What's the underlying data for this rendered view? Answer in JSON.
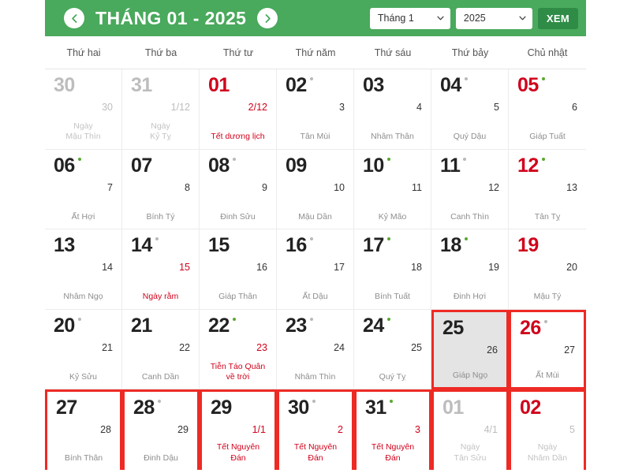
{
  "header": {
    "prev_icon": "chevron-left-icon",
    "next_icon": "chevron-right-icon",
    "title": "THÁNG 01 - 2025",
    "month_select_value": "Tháng 1",
    "year_select_value": "2025",
    "view_button_label": "XEM",
    "chevron_icon": "chevron-down-icon",
    "background_color": "#49a95c",
    "button_color": "#2f8c47"
  },
  "weekdays": [
    "Thứ hai",
    "Thứ ba",
    "Thứ tư",
    "Thứ năm",
    "Thứ sáu",
    "Thứ bảy",
    "Chủ nhật"
  ],
  "colors": {
    "holiday_red": "#d0021b",
    "marked_border": "#ee2a24",
    "good_day_dot": "#5aa832",
    "normal_day_dot": "#b9b9b9",
    "today_background": "#e4e4e4",
    "muted_text": "#bdbdbd"
  },
  "days": [
    {
      "day": "30",
      "lunar": "30",
      "label": "Ngày\nMậu Thìn",
      "dot": "none",
      "classes": "out"
    },
    {
      "day": "31",
      "lunar": "1/12",
      "label": "Ngày\nKỷ Tỵ",
      "dot": "none",
      "classes": "out"
    },
    {
      "day": "01",
      "lunar": "2/12",
      "label": "Tết dương lịch",
      "dot": "none",
      "classes": "red-num holiday"
    },
    {
      "day": "02",
      "lunar": "3",
      "label": "Tân Mùi",
      "dot": "grey",
      "classes": ""
    },
    {
      "day": "03",
      "lunar": "4",
      "label": "Nhâm Thân",
      "dot": "none",
      "classes": ""
    },
    {
      "day": "04",
      "lunar": "5",
      "label": "Quý Dậu",
      "dot": "grey",
      "classes": ""
    },
    {
      "day": "05",
      "lunar": "6",
      "label": "Giáp Tuất",
      "dot": "green",
      "classes": "sun"
    },
    {
      "day": "06",
      "lunar": "7",
      "label": "Ất Hợi",
      "dot": "green",
      "classes": ""
    },
    {
      "day": "07",
      "lunar": "8",
      "label": "Bính Tý",
      "dot": "none",
      "classes": ""
    },
    {
      "day": "08",
      "lunar": "9",
      "label": "Đinh Sửu",
      "dot": "grey",
      "classes": ""
    },
    {
      "day": "09",
      "lunar": "10",
      "label": "Mậu Dần",
      "dot": "none",
      "classes": ""
    },
    {
      "day": "10",
      "lunar": "11",
      "label": "Kỷ Mão",
      "dot": "green",
      "classes": ""
    },
    {
      "day": "11",
      "lunar": "12",
      "label": "Canh Thìn",
      "dot": "grey",
      "classes": ""
    },
    {
      "day": "12",
      "lunar": "13",
      "label": "Tân Tỵ",
      "dot": "green",
      "classes": "sun"
    },
    {
      "day": "13",
      "lunar": "14",
      "label": "Nhâm Ngọ",
      "dot": "none",
      "classes": ""
    },
    {
      "day": "14",
      "lunar": "15",
      "label": "Ngày rằm",
      "dot": "grey",
      "classes": "holiday"
    },
    {
      "day": "15",
      "lunar": "16",
      "label": "Giáp Thân",
      "dot": "none",
      "classes": ""
    },
    {
      "day": "16",
      "lunar": "17",
      "label": "Ất Dậu",
      "dot": "grey",
      "classes": ""
    },
    {
      "day": "17",
      "lunar": "18",
      "label": "Bính Tuất",
      "dot": "green",
      "classes": ""
    },
    {
      "day": "18",
      "lunar": "19",
      "label": "Đinh Hợi",
      "dot": "green",
      "classes": ""
    },
    {
      "day": "19",
      "lunar": "20",
      "label": "Mậu Tý",
      "dot": "none",
      "classes": "sun"
    },
    {
      "day": "20",
      "lunar": "21",
      "label": "Kỷ Sửu",
      "dot": "grey",
      "classes": ""
    },
    {
      "day": "21",
      "lunar": "22",
      "label": "Canh Dần",
      "dot": "none",
      "classes": ""
    },
    {
      "day": "22",
      "lunar": "23",
      "label": "Tiễn Táo Quân\nvề trời",
      "dot": "green",
      "classes": "holiday"
    },
    {
      "day": "23",
      "lunar": "24",
      "label": "Nhâm Thìn",
      "dot": "grey",
      "classes": ""
    },
    {
      "day": "24",
      "lunar": "25",
      "label": "Quý Tỵ",
      "dot": "green",
      "classes": ""
    },
    {
      "day": "25",
      "lunar": "26",
      "label": "Giáp Ngọ",
      "dot": "none",
      "classes": "today marked"
    },
    {
      "day": "26",
      "lunar": "27",
      "label": "Ất Mùi",
      "dot": "grey",
      "classes": "sun marked"
    },
    {
      "day": "27",
      "lunar": "28",
      "label": "Bính Thân",
      "dot": "none",
      "classes": "marked"
    },
    {
      "day": "28",
      "lunar": "29",
      "label": "Đinh Dậu",
      "dot": "grey",
      "classes": "marked"
    },
    {
      "day": "29",
      "lunar": "1/1",
      "label": "Tết Nguyên\nĐán",
      "dot": "none",
      "classes": "holiday marked"
    },
    {
      "day": "30",
      "lunar": "2",
      "label": "Tết Nguyên\nĐán",
      "dot": "grey",
      "classes": "holiday marked"
    },
    {
      "day": "31",
      "lunar": "3",
      "label": "Tết Nguyên\nĐán",
      "dot": "green",
      "classes": "holiday marked"
    },
    {
      "day": "01",
      "lunar": "4/1",
      "label": "Ngày\nTân Sửu",
      "dot": "none",
      "classes": "out marked"
    },
    {
      "day": "02",
      "lunar": "5",
      "label": "Ngày\nNhâm Dần",
      "dot": "none",
      "classes": "out red-num marked"
    }
  ]
}
